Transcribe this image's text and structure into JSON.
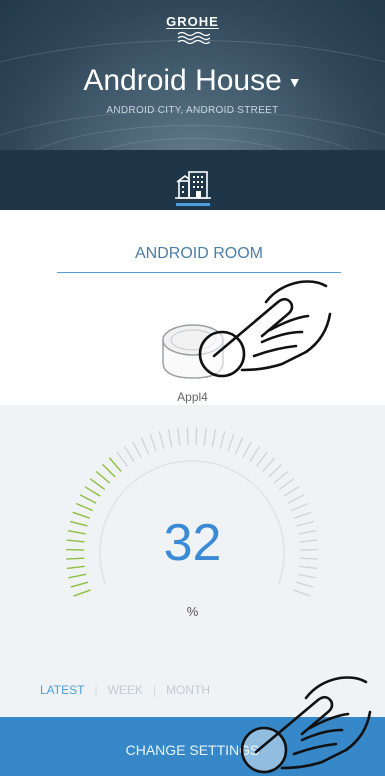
{
  "header": {
    "brand": "GROHE",
    "house_title": "Android House",
    "house_address": "ANDROID CITY, ANDROID STREET",
    "dropdown_icon": "caret-down-icon",
    "nav_icon": "home-building-icon"
  },
  "room": {
    "tab_label": "ANDROID ROOM",
    "appliance_label": "Appl4",
    "appliance_icon": "sense-device-icon"
  },
  "gauge": {
    "value": "32",
    "unit": "%",
    "level_percent": 32
  },
  "period_tabs": [
    {
      "label": "LATEST",
      "active": true
    },
    {
      "label": "WEEK",
      "active": false
    },
    {
      "label": "MONTH",
      "active": false
    }
  ],
  "footer": {
    "button_label": "CHANGE SETTINGS"
  },
  "colors": {
    "accent": "#3a8ad6",
    "footer_bg": "#3788c8",
    "header_dark": "#1f3649",
    "gauge_green": "#8cbf3f"
  }
}
